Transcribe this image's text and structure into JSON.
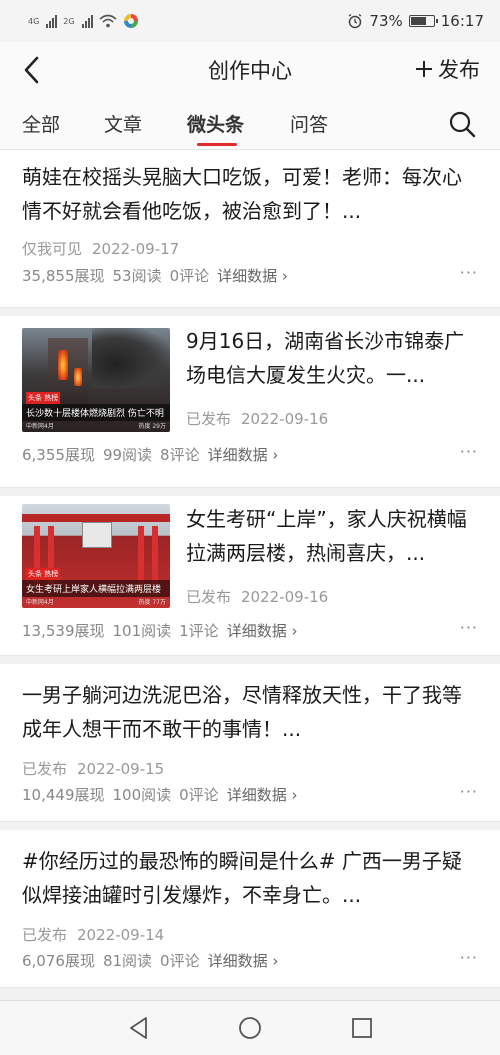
{
  "status_bar": {
    "signal1_label": "4G",
    "signal2_label": "2G",
    "battery": "73%",
    "time": "16:17",
    "battery_level": 0.73,
    "icons": [
      "signal-icon",
      "wifi-icon",
      "app-icon",
      "alarm-icon",
      "battery-icon"
    ]
  },
  "header": {
    "title": "创作中心",
    "publish_label": "发布",
    "icons": [
      "back-arrow-icon",
      "plus-icon"
    ]
  },
  "tabs": [
    {
      "label": "全部",
      "active": false
    },
    {
      "label": "文章",
      "active": false
    },
    {
      "label": "微头条",
      "active": true
    },
    {
      "label": "问答",
      "active": false
    }
  ],
  "accent_color": "#e02b2b",
  "feed": [
    {
      "title": "萌娃在校摇头晃脑大口吃饭，可爱！老师：每次心情不好就会看他吃饭，被治愈到了！...",
      "status": "仅我可见",
      "date": "2022-09-17",
      "views": "35,855展现",
      "reads": "53阅读",
      "comments": "0评论",
      "detail": "详细数据 ›",
      "more": "···"
    },
    {
      "title": "9月16日，湖南省长沙市锦泰广场电信大厦发生火灾。一...",
      "status": "已发布",
      "date": "2022-09-16",
      "views": "6,355展现",
      "reads": "99阅读",
      "comments": "8评论",
      "detail": "详细数据 ›",
      "more": "···",
      "thumb": {
        "tag": "头条 热榜",
        "caption": "长沙数十层楼体燃烧剧烈 伤亡不明",
        "meta_left": "中新网4月",
        "meta_right": "热度 29万"
      }
    },
    {
      "title": "女生考研“上岸”，家人庆祝横幅拉满两层楼，热闹喜庆，...",
      "status": "已发布",
      "date": "2022-09-16",
      "views": "13,539展现",
      "reads": "101阅读",
      "comments": "1评论",
      "detail": "详细数据 ›",
      "more": "···",
      "thumb": {
        "tag": "头条 热榜",
        "caption": "女生考研上岸家人横幅拉满两层楼",
        "meta_left": "中新网4月",
        "meta_right": "热度 77万"
      }
    },
    {
      "title": "一男子躺河边洗泥巴浴，尽情释放天性，干了我等成年人想干而不敢干的事情！...",
      "status": "已发布",
      "date": "2022-09-15",
      "views": "10,449展现",
      "reads": "100阅读",
      "comments": "0评论",
      "detail": "详细数据 ›",
      "more": "···"
    },
    {
      "title": "#你经历过的最恐怖的瞬间是什么# 广西一男子疑似焊接油罐时引发爆炸，不幸身亡。...",
      "status": "已发布",
      "date": "2022-09-14",
      "views": "6,076展现",
      "reads": "81阅读",
      "comments": "0评论",
      "detail": "详细数据 ›",
      "more": "···"
    }
  ],
  "nav": {
    "icons": [
      "back-triangle-icon",
      "home-circle-icon",
      "recents-square-icon"
    ]
  }
}
